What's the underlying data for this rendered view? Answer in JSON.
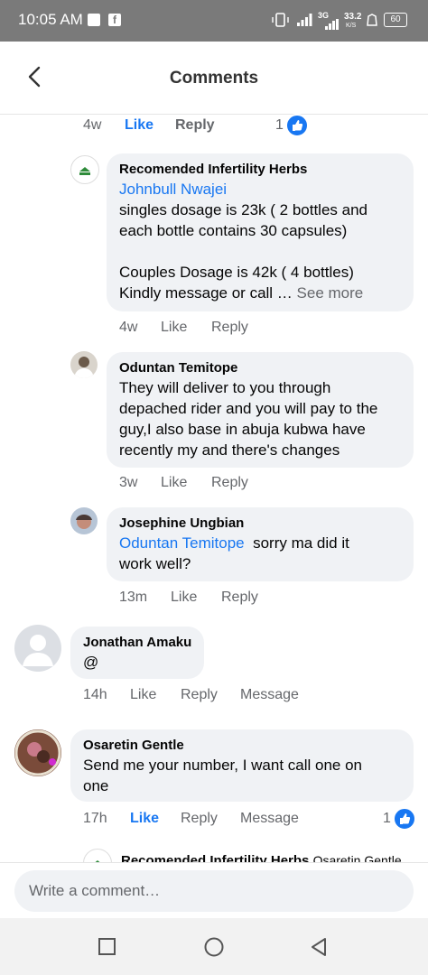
{
  "status_bar": {
    "time": "10:05 AM",
    "network_label": "3G",
    "data_speed_value": "33.2",
    "data_speed_unit": "K/S",
    "battery": "60",
    "icons": [
      "notification-square-icon",
      "facebook-icon",
      "vibrate-icon",
      "signal-icon",
      "signal-3g-icon",
      "alarm-icon",
      "battery-icon"
    ]
  },
  "header": {
    "title": "Comments",
    "back_icon": "arrow-left-icon"
  },
  "top_actions": {
    "time": "4w",
    "like": "Like",
    "reply": "Reply",
    "like_count": "1"
  },
  "comments": [
    {
      "author": "Recomended Infertility Herbs",
      "mention": "Johnbull Nwajei",
      "lines": [
        " singles dosage is 23k ( 2 bottles and",
        "each bottle contains 30 capsules)",
        "",
        "Couples Dosage is 42k ( 4 bottles)",
        "Kindly message or call …"
      ],
      "see_more": "See more",
      "time": "4w",
      "like": "Like",
      "reply": "Reply"
    },
    {
      "author": "Oduntan Temitope",
      "lines": [
        "They will deliver to you through",
        "depached rider and you will pay to the",
        "guy,I also base in abuja kubwa have",
        "recently my and there's changes"
      ],
      "time": "3w",
      "like": "Like",
      "reply": "Reply"
    },
    {
      "author": "Josephine Ungbian",
      "mention": "Oduntan Temitope",
      "lines": [
        "sorry ma did it",
        "work well?"
      ],
      "time": "13m",
      "like": "Like",
      "reply": "Reply"
    },
    {
      "author": "Jonathan Amaku",
      "lines": [
        "@"
      ],
      "time": "14h",
      "like": "Like",
      "reply": "Reply",
      "message": "Message"
    },
    {
      "author": "Osaretin Gentle",
      "lines": [
        "Send me your number, I want call one on",
        "one"
      ],
      "time": "17h",
      "like": "Like",
      "reply": "Reply",
      "message": "Message",
      "like_count": "1"
    },
    {
      "author": "Recomended Infertility Herbs",
      "mention": "Osaretin Gentle"
    }
  ],
  "composer": {
    "placeholder": "Write a comment…"
  },
  "nav": {
    "icons": [
      "recent-apps-icon",
      "home-icon",
      "back-triangle-icon"
    ]
  },
  "colors": {
    "accent": "#1877f2",
    "bubble": "#f0f2f5",
    "secondary_text": "#65676b",
    "status_bar": "#7a7a7a"
  }
}
